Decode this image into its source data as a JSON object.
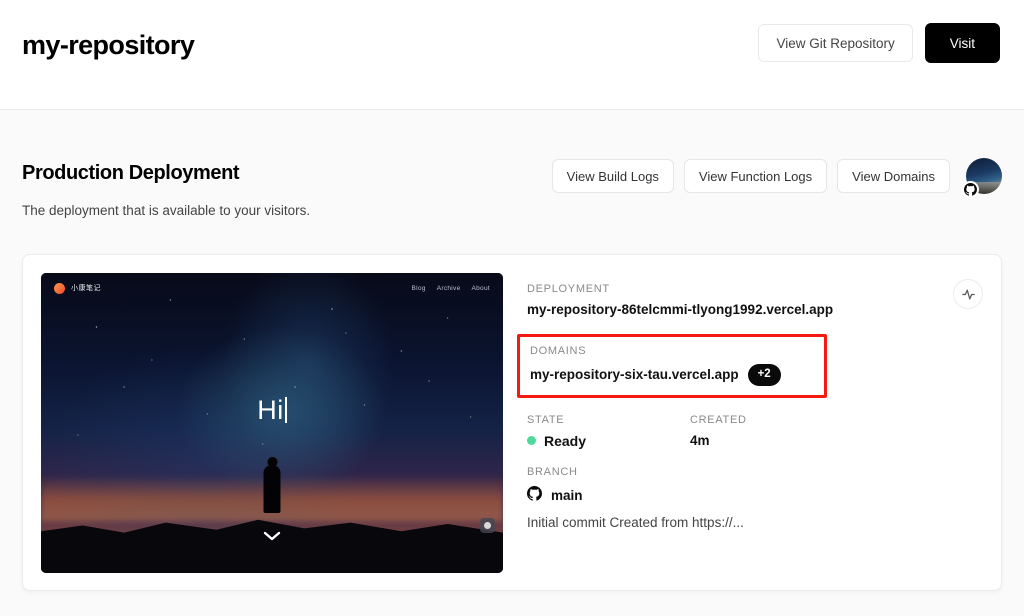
{
  "header": {
    "repo_title": "my-repository",
    "view_git_repository_label": "View Git Repository",
    "visit_label": "Visit"
  },
  "production": {
    "title": "Production Deployment",
    "subtitle": "The deployment that is available to your visitors.",
    "view_build_logs_label": "View Build Logs",
    "view_function_logs_label": "View Function Logs",
    "view_domains_label": "View Domains"
  },
  "card": {
    "preview": {
      "logo_text": "小康笔记",
      "nav": [
        "Blog",
        "Archive",
        "About"
      ],
      "hero_text": "Hi"
    },
    "deployment": {
      "label": "DEPLOYMENT",
      "url": "my-repository-86telcmmi-tlyong1992.vercel.app"
    },
    "domains": {
      "label": "DOMAINS",
      "primary": "my-repository-six-tau.vercel.app",
      "more_count": "+2",
      "highlight_color": "#f5190f"
    },
    "state": {
      "label": "STATE",
      "value": "Ready",
      "dot_color": "#4cdb9b"
    },
    "created": {
      "label": "CREATED",
      "value": "4m"
    },
    "branch": {
      "label": "BRANCH",
      "name": "main",
      "commit_message": "Initial commit Created from https://..."
    }
  }
}
